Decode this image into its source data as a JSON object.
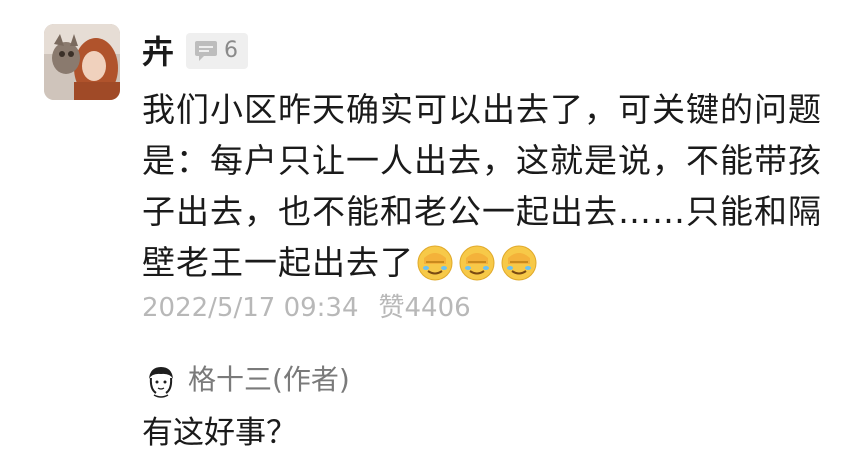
{
  "comment": {
    "username": "卉",
    "level": "6",
    "avatar_icon": "user-photo-avatar",
    "badge_icon": "comment-bubble-icon",
    "text": "我们小区昨天确实可以出去了，可关键的问题是：每户只让一人出去，这就是说，不能带孩子出去，也不能和老公一起出去……只能和隔壁老王一起出去了",
    "emojis": [
      "facepalm-emoji",
      "facepalm-emoji",
      "facepalm-emoji"
    ],
    "date": "2022/5/17 09:34",
    "likes": "赞4406"
  },
  "reply": {
    "author": "格十三(作者)",
    "avatar_icon": "sketch-avatar",
    "text": "有这好事？"
  },
  "colors": {
    "text_primary": "#1a1a1a",
    "text_meta": "#b8b8b8",
    "text_author": "#7a7a7a",
    "badge_bg": "#efefef",
    "emoji_face": "#f7c948"
  }
}
